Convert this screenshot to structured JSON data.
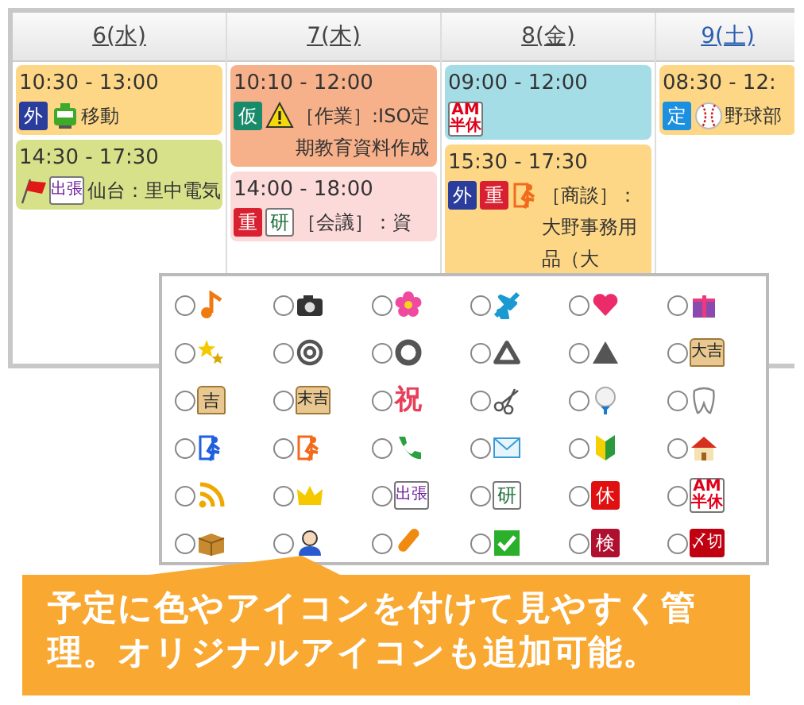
{
  "calendar": {
    "days": [
      {
        "label": "6(水)",
        "color": "#444444",
        "events": [
          {
            "time": "10:30 - 13:00",
            "color": "#fdd785",
            "icons": [
              {
                "kind": "solid",
                "text": "外",
                "color": "#2a3c9c"
              },
              {
                "kind": "tram"
              }
            ],
            "title": "移動"
          },
          {
            "time": "14:30 - 17:30",
            "color": "#d6e18a",
            "icons": [
              {
                "kind": "flag"
              },
              {
                "kind": "outline",
                "text": "出張",
                "color": "#6a1a9a"
              }
            ],
            "title": "仙台：里中電気"
          }
        ]
      },
      {
        "label": "7(木)",
        "color": "#444444",
        "events": [
          {
            "time": "10:10 - 12:00",
            "color": "#f6b08a",
            "icons": [
              {
                "kind": "solid",
                "text": "仮",
                "color": "#198a6a"
              },
              {
                "kind": "warning"
              }
            ],
            "title": "［作業］:ISO定期教育資料作成"
          },
          {
            "time": "14:00 - 18:00",
            "color": "#fddada",
            "icons": [
              {
                "kind": "solid",
                "text": "重",
                "color": "#d92030"
              },
              {
                "kind": "outline",
                "text": "研",
                "color": "#1f6f3a"
              }
            ],
            "title": "［会議］：資"
          }
        ]
      },
      {
        "label": "8(金)",
        "color": "#444444",
        "events": [
          {
            "time": "09:00 - 12:00",
            "color": "#a5dde6",
            "icons": [
              {
                "kind": "outline",
                "text": "AM半休",
                "color": "#e0001a"
              }
            ]
          },
          {
            "time": "15:30 - 17:30",
            "color": "#fdd785",
            "icons": [
              {
                "kind": "solid",
                "text": "外",
                "color": "#2a3c9c"
              },
              {
                "kind": "solid",
                "text": "重",
                "color": "#d92030"
              },
              {
                "kind": "runner",
                "color": "#f26a1b"
              }
            ],
            "title": "［商談］：大野事務用品（大"
          }
        ]
      },
      {
        "label": "9(土)",
        "color": "#2a5fb0",
        "events": [
          {
            "time": "08:30 - 12:",
            "color": "#fdd785",
            "icons": [
              {
                "kind": "solid",
                "text": "定",
                "color": "#1b8fe0"
              },
              {
                "kind": "baseball"
              }
            ],
            "title": "野球部"
          }
        ]
      }
    ]
  },
  "icon_picker": {
    "options": [
      {
        "icon": {
          "kind": "note"
        },
        "selected": false
      },
      {
        "icon": {
          "kind": "camera"
        },
        "selected": false
      },
      {
        "icon": {
          "kind": "flower"
        },
        "selected": false
      },
      {
        "icon": {
          "kind": "plane"
        },
        "selected": false
      },
      {
        "icon": {
          "kind": "heart"
        },
        "selected": false
      },
      {
        "icon": {
          "kind": "gift"
        },
        "selected": false
      },
      {
        "icon": {
          "kind": "stars"
        },
        "selected": false
      },
      {
        "icon": {
          "kind": "target"
        },
        "selected": false
      },
      {
        "icon": {
          "kind": "ring"
        },
        "selected": false
      },
      {
        "icon": {
          "kind": "triangle-outline"
        },
        "selected": false
      },
      {
        "icon": {
          "kind": "triangle"
        },
        "selected": false
      },
      {
        "icon": {
          "kind": "omikuji",
          "text": "大吉"
        },
        "selected": false
      },
      {
        "icon": {
          "kind": "omikuji",
          "text": "吉"
        },
        "selected": false
      },
      {
        "icon": {
          "kind": "omikuji",
          "text": "末吉"
        },
        "selected": false
      },
      {
        "icon": {
          "kind": "plain",
          "text": "祝",
          "color": "#e8405a"
        },
        "selected": false
      },
      {
        "icon": {
          "kind": "scissors"
        },
        "selected": false
      },
      {
        "icon": {
          "kind": "golf"
        },
        "selected": false
      },
      {
        "icon": {
          "kind": "tooth"
        },
        "selected": false
      },
      {
        "icon": {
          "kind": "runner",
          "color": "#1f5fe0"
        },
        "selected": false
      },
      {
        "icon": {
          "kind": "runner",
          "color": "#f26a1b"
        },
        "selected": false
      },
      {
        "icon": {
          "kind": "phone"
        },
        "selected": false
      },
      {
        "icon": {
          "kind": "mail"
        },
        "selected": false
      },
      {
        "icon": {
          "kind": "beginner"
        },
        "selected": false
      },
      {
        "icon": {
          "kind": "house"
        },
        "selected": false
      },
      {
        "icon": {
          "kind": "rss"
        },
        "selected": false
      },
      {
        "icon": {
          "kind": "crown"
        },
        "selected": false
      },
      {
        "icon": {
          "kind": "outline",
          "text": "出張",
          "color": "#6a1a9a"
        },
        "selected": false
      },
      {
        "icon": {
          "kind": "outline",
          "text": "研",
          "color": "#1f6f3a"
        },
        "selected": false
      },
      {
        "icon": {
          "kind": "solid",
          "text": "休",
          "color": "#e01010"
        },
        "selected": false
      },
      {
        "icon": {
          "kind": "outline",
          "text": "AM半休",
          "color": "#e0001a"
        },
        "selected": false
      },
      {
        "icon": {
          "kind": "box"
        },
        "selected": false
      },
      {
        "icon": {
          "kind": "person"
        },
        "selected": false
      },
      {
        "icon": {
          "kind": "bandage"
        },
        "selected": false
      },
      {
        "icon": {
          "kind": "check"
        },
        "selected": false
      },
      {
        "icon": {
          "kind": "solid",
          "text": "検",
          "color": "#b01030"
        },
        "selected": false
      },
      {
        "icon": {
          "kind": "solid",
          "text": "〆切",
          "color": "#c00010"
        },
        "selected": false
      }
    ]
  },
  "callout": {
    "text": "予定に色やアイコンを付けて見やすく管理。オリジナルアイコンも追加可能。"
  }
}
